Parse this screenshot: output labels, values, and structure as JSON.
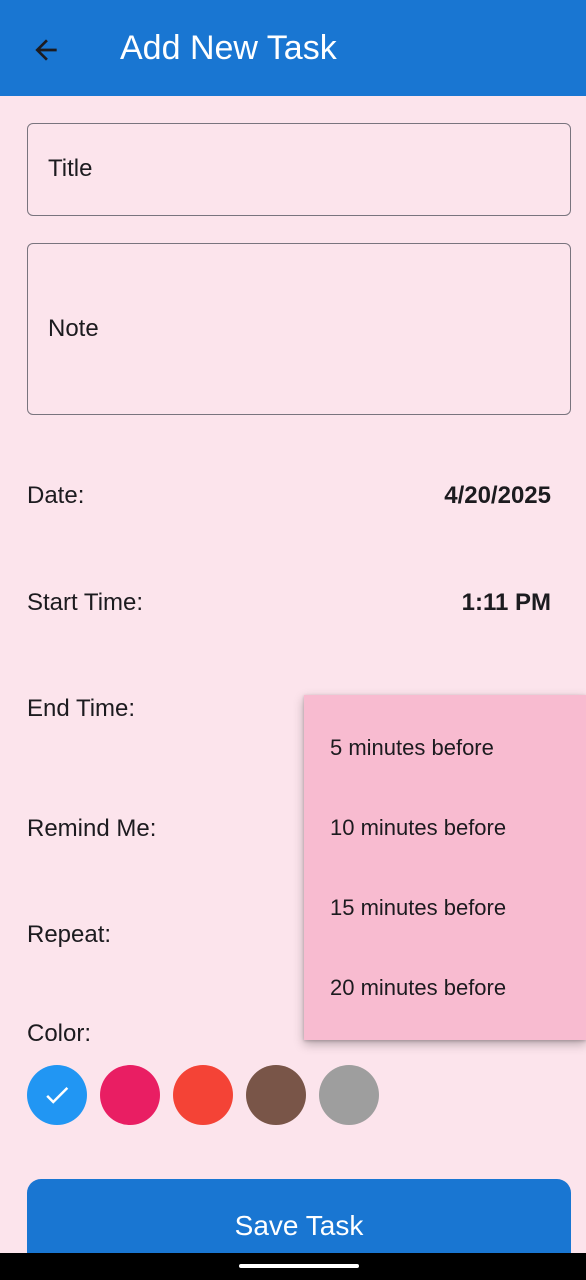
{
  "app_bar": {
    "title": "Add New Task",
    "background_color": "#1976d2",
    "back_icon": "arrow-back-icon"
  },
  "form": {
    "title_placeholder": "Title",
    "note_placeholder": "Note",
    "date_label": "Date:",
    "date_value": "4/20/2025",
    "start_time_label": "Start Time:",
    "start_time_value": "1:11 PM",
    "end_time_label": "End Time:",
    "remind_label": "Remind Me:",
    "repeat_label": "Repeat:",
    "color_label": "Color:"
  },
  "colors": {
    "options": [
      "#2196f3",
      "#e91e63",
      "#f44336",
      "#795548",
      "#9e9e9e"
    ],
    "selected_index": 0,
    "selected_icon": "check-icon"
  },
  "remind_menu": {
    "options": [
      "5 minutes before",
      "10 minutes before",
      "15 minutes before",
      "20 minutes before"
    ],
    "background_color": "#f8bbd0"
  },
  "save_button": {
    "label": "Save Task",
    "color": "#1976d2"
  },
  "theme": {
    "page_background": "#fce4ec"
  }
}
